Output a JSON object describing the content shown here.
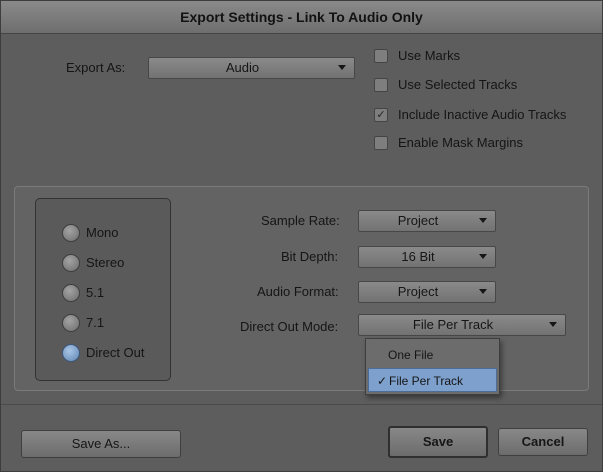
{
  "window": {
    "title": "Export Settings - Link To Audio Only"
  },
  "export": {
    "label": "Export As:",
    "value": "Audio"
  },
  "options": [
    {
      "label": "Use Marks",
      "checked": false
    },
    {
      "label": "Use Selected Tracks",
      "checked": false
    },
    {
      "label": "Include Inactive Audio Tracks",
      "checked": true
    },
    {
      "label": "Enable Mask Margins",
      "checked": false
    }
  ],
  "check_mark": "✓",
  "channels": [
    {
      "label": "Mono",
      "selected": false
    },
    {
      "label": "Stereo",
      "selected": false
    },
    {
      "label": "5.1",
      "selected": false
    },
    {
      "label": "7.1",
      "selected": false
    },
    {
      "label": "Direct Out",
      "selected": true
    }
  ],
  "settings": {
    "sample_rate": {
      "label": "Sample Rate:",
      "value": "Project"
    },
    "bit_depth": {
      "label": "Bit Depth:",
      "value": "16 Bit"
    },
    "audio_format": {
      "label": "Audio Format:",
      "value": "Project"
    },
    "direct_out_mode": {
      "label": "Direct Out Mode:",
      "value": "File Per Track"
    }
  },
  "direct_out_menu": {
    "items": [
      {
        "label": "One File",
        "check": ""
      },
      {
        "label": "File Per Track",
        "check": "✓"
      }
    ]
  },
  "buttons": {
    "save_as": "Save As...",
    "save": "Save",
    "cancel": "Cancel"
  },
  "colors": {
    "selection": "#7ea0cd",
    "background": "#5d5d5d"
  }
}
